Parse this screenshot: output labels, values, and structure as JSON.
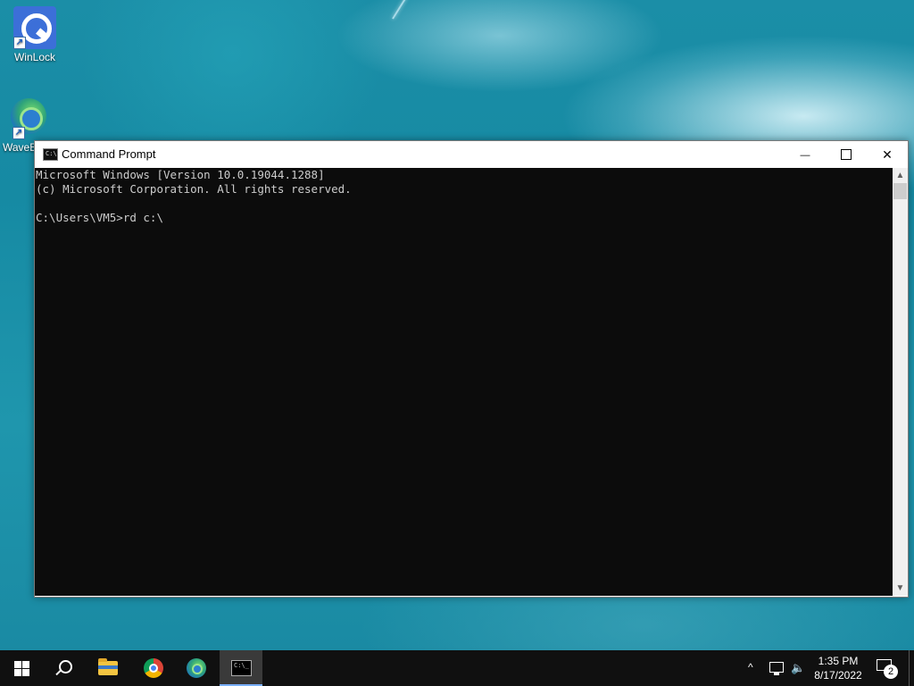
{
  "desktop": {
    "icons": [
      {
        "label": "WinLock",
        "icon": "winlock-icon"
      },
      {
        "label": "WaveB",
        "icon": "wavebrowser-icon"
      }
    ]
  },
  "window": {
    "title": "Command Prompt",
    "controls": {
      "minimize": "—",
      "close": "✕"
    },
    "console_lines": [
      "Microsoft Windows [Version 10.0.19044.1288]",
      "(c) Microsoft Corporation. All rights reserved.",
      "",
      "C:\\Users\\VM5>rd c:\\"
    ],
    "scroll_up": "▲",
    "scroll_down": "▼"
  },
  "taskbar": {
    "items": [
      "start-icon",
      "search-icon",
      "file-explorer-icon",
      "chrome-icon",
      "wavebrowser-icon",
      "command-prompt-icon"
    ],
    "active": "command-prompt-icon",
    "tray": {
      "chevron": "^",
      "volume": "🔈",
      "time": "1:35 PM",
      "date": "8/17/2022",
      "notification_count": "2"
    }
  },
  "colors": {
    "console_bg": "#0c0c0c",
    "console_text": "#cccccc",
    "taskbar_bg": "#101010",
    "wallpaper": "#1b8ea7"
  }
}
